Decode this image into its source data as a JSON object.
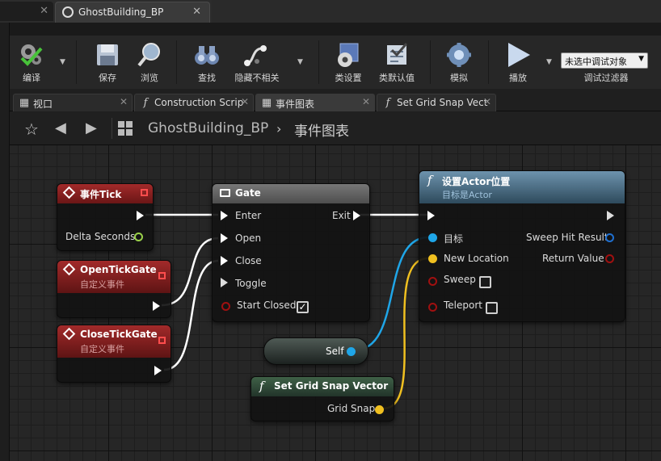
{
  "doc_tabs": {
    "active_label": "GhostBuilding_BP",
    "close_glyph": "✕"
  },
  "toolbar": {
    "compile": "编译",
    "save": "保存",
    "browse": "浏览",
    "find": "查找",
    "hide_unrelated": "隐藏不相关",
    "class_settings": "类设置",
    "class_defaults": "类默认值",
    "simulate": "模拟",
    "play": "播放",
    "debug_object": "未选中调试对象",
    "debug_filter": "调试过滤器"
  },
  "graph_tabs": [
    {
      "label": "视口",
      "icon": "viewport-icon"
    },
    {
      "label": "Construction Scrip",
      "icon": "function-icon"
    },
    {
      "label": "事件图表",
      "icon": "event-graph-icon"
    },
    {
      "label": "Set Grid Snap Vect",
      "icon": "function-icon"
    }
  ],
  "breadcrumb": {
    "root": "GhostBuilding_BP",
    "separator": "›",
    "current": "事件图表"
  },
  "nodes": {
    "tick": {
      "title": "事件Tick",
      "pin_delta": "Delta Seconds"
    },
    "open_gate": {
      "title": "OpenTickGate",
      "subtitle": "自定义事件"
    },
    "close_gate": {
      "title": "CloseTickGate",
      "subtitle": "自定义事件"
    },
    "gate": {
      "title": "Gate",
      "enter": "Enter",
      "open": "Open",
      "close": "Close",
      "toggle": "Toggle",
      "start_closed": "Start Closed",
      "exit": "Exit",
      "start_closed_checked": true
    },
    "set_loc": {
      "title": "设置Actor位置",
      "subtitle": "目标是Actor",
      "target": "目标",
      "new_location": "New Location",
      "sweep": "Sweep",
      "teleport": "Teleport",
      "sweep_hit": "Sweep Hit Result",
      "return_value": "Return Value"
    },
    "self": {
      "label": "Self"
    },
    "snap": {
      "title": "Set Grid Snap Vector",
      "pin": "Grid Snap"
    }
  },
  "colors": {
    "event_header": "#8a1f1f",
    "function_header": "#4a6f86",
    "gate_header": "#6a6a6a",
    "snap_header": "#2f4a34",
    "object_pin": "#1fa6e8",
    "vector_pin": "#f0c020",
    "float_pin": "#9ad04a",
    "bool_pin": "#a01010"
  }
}
